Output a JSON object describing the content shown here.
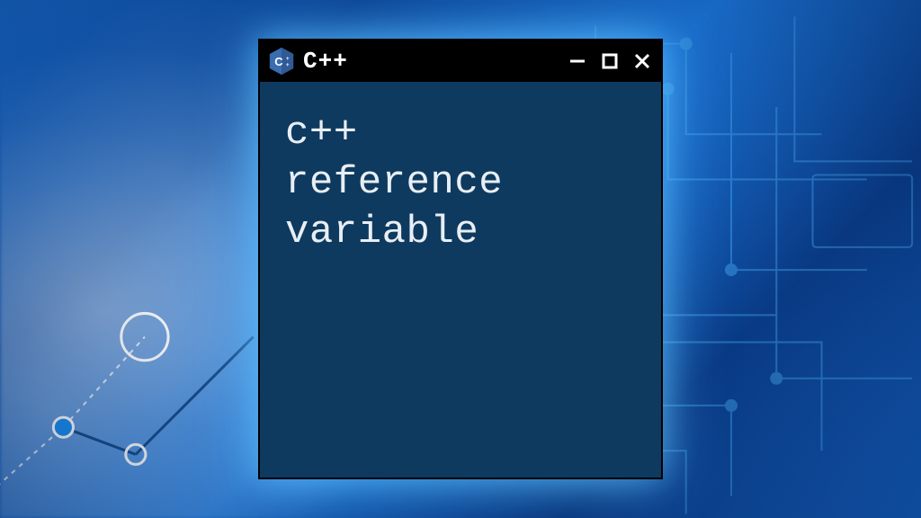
{
  "window": {
    "title": "C++",
    "icon_name": "cpp-language-icon",
    "controls": {
      "minimize": "minimize",
      "maximize": "maximize",
      "close": "close"
    }
  },
  "content": {
    "line1": "c++",
    "line2": "reference",
    "line3": "variable"
  },
  "colors": {
    "window_bg": "#0e3a5f",
    "titlebar_bg": "#000000",
    "text": "#e8eef4",
    "glow": "#5cc8ff"
  }
}
